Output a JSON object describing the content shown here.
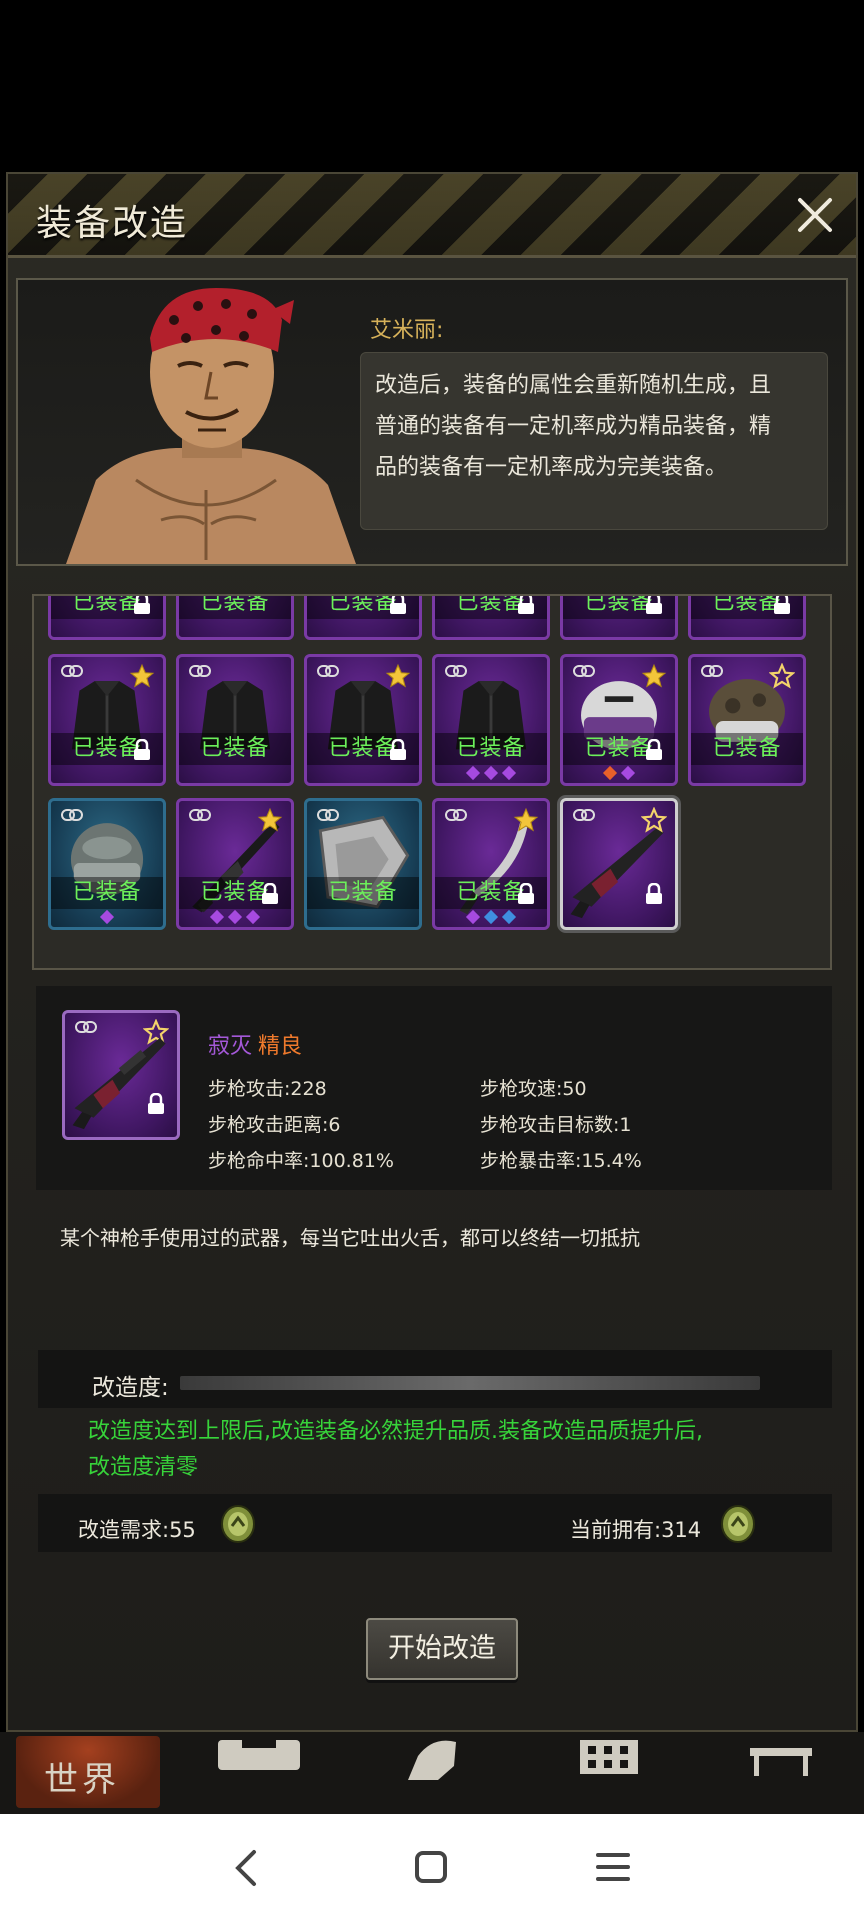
{
  "header": {
    "title": "装备改造"
  },
  "dialog": {
    "speaker": "艾米丽:",
    "lines": [
      "改造后，装备的属性会重新随机生成，且",
      "普通的装备有一定机率成为精品装备，精",
      "品的装备有一定机率成为完美装备。"
    ]
  },
  "grid": {
    "equipped_label": "已装备",
    "rows": [
      [
        {
          "type": "partial",
          "equipped": true,
          "locked": true
        },
        {
          "type": "partial",
          "equipped": true,
          "locked": false
        },
        {
          "type": "partial",
          "equipped": true,
          "locked": true
        },
        {
          "type": "partial",
          "equipped": true,
          "locked": true
        },
        {
          "type": "partial",
          "equipped": true,
          "locked": true
        },
        {
          "type": "partial",
          "equipped": true,
          "locked": true
        }
      ],
      [
        {
          "item": "jacket-icon",
          "equipped": true,
          "locked": true,
          "star": "gold"
        },
        {
          "item": "jacket-icon",
          "equipped": true,
          "locked": false,
          "star": ""
        },
        {
          "item": "jacket-icon",
          "equipped": true,
          "locked": true,
          "star": "gold"
        },
        {
          "item": "jacket-icon",
          "equipped": true,
          "locked": false,
          "star": "",
          "gems": [
            "#a64ae0",
            "#a64ae0",
            "#a64ae0"
          ]
        },
        {
          "item": "police-helmet-icon",
          "equipped": true,
          "locked": true,
          "star": "gold",
          "gems": [
            "#e8602a",
            "#a64ae0"
          ]
        },
        {
          "item": "military-helmet-icon",
          "equipped": true,
          "locked": false,
          "star": "outline"
        }
      ],
      [
        {
          "item": "helmet-icon",
          "equipped": true,
          "locked": false,
          "star": "",
          "color": "blue",
          "gems": [
            "#a64ae0"
          ]
        },
        {
          "item": "rifle-icon",
          "equipped": true,
          "locked": true,
          "star": "gold",
          "gems": [
            "#a64ae0",
            "#a64ae0",
            "#a64ae0"
          ]
        },
        {
          "item": "shield-icon",
          "equipped": true,
          "locked": false,
          "star": "",
          "color": "blue"
        },
        {
          "item": "machete-icon",
          "equipped": true,
          "locked": true,
          "star": "gold",
          "gems": [
            "#a64ae0",
            "#3f8fe0",
            "#3f8fe0"
          ]
        },
        {
          "item": "sniper-rifle-icon",
          "equipped": false,
          "locked": true,
          "star": "outline",
          "selected": true
        }
      ]
    ]
  },
  "detail": {
    "name_part1": "寂灭",
    "name_part2": "精良",
    "stats": {
      "attack": "步枪攻击:228",
      "speed": "步枪攻速:50",
      "range": "步枪攻击距离:6",
      "targets": "步枪攻击目标数:1",
      "accuracy": "步枪命中率:100.81%",
      "crit": "步枪暴击率:15.4%"
    },
    "description": "某个神枪手使用过的武器，每当它吐出火舌，都可以终结一切抵抗"
  },
  "modify": {
    "progress_label": "改造度:",
    "progress_value": 0,
    "note": "改造度达到上限后,改造装备必然提升品质.装备改造品质提升后,改造度清零",
    "cost_label": "改造需求:55",
    "have_label": "当前拥有:314",
    "start_button": "开始改造"
  },
  "game_nav": {
    "world": "世界"
  },
  "colors": {
    "equipped": "#6cf05a",
    "note": "#37d43a",
    "epic": "#a458d8",
    "quality": "#f07a2c"
  }
}
